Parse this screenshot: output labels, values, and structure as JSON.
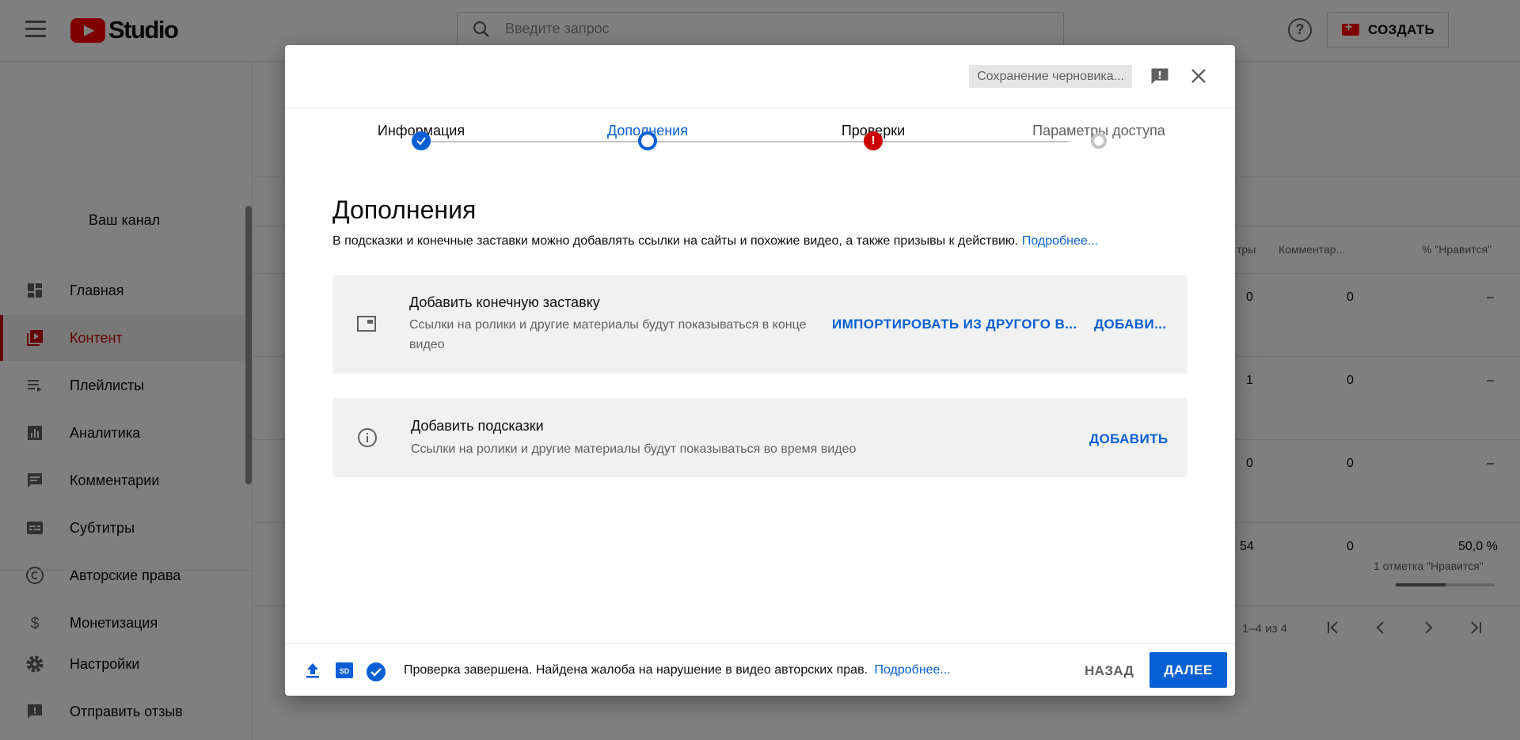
{
  "app": {
    "logo_text": "Studio",
    "create_label": "СОЗДАТЬ",
    "help_glyph": "?"
  },
  "search": {
    "placeholder": "Введите запрос"
  },
  "sidebar": {
    "channel_label": "Ваш канал",
    "items": [
      {
        "label": "Главная",
        "icon": "dashboard-icon"
      },
      {
        "label": "Контент",
        "icon": "content-icon",
        "active": true
      },
      {
        "label": "Плейлисты",
        "icon": "playlist-icon"
      },
      {
        "label": "Аналитика",
        "icon": "analytics-icon"
      },
      {
        "label": "Комментарии",
        "icon": "comments-icon"
      },
      {
        "label": "Субтитры",
        "icon": "subtitles-icon"
      },
      {
        "label": "Авторские права",
        "icon": "copyright-icon"
      },
      {
        "label": "Монетизация",
        "icon": "dollar-icon"
      },
      {
        "label": "Настройки",
        "icon": "gear-icon"
      },
      {
        "label": "Отправить отзыв",
        "icon": "feedback-icon"
      }
    ]
  },
  "table": {
    "headers": {
      "views": "тры",
      "comments": "Комментар...",
      "likes": "% \"Нравится\""
    },
    "rows": [
      {
        "views": "0",
        "comments": "0",
        "likes": "–"
      },
      {
        "views": "1",
        "comments": "0",
        "likes": "–"
      },
      {
        "views": "0",
        "comments": "0",
        "likes": "–"
      },
      {
        "views": "54",
        "comments": "0",
        "likes": "50,0 %",
        "likes_sub": "1 отметка \"Нравится\"",
        "likes_ratio": 0.5
      }
    ],
    "pager": "1–4 из 4"
  },
  "dialog": {
    "draft_status": "Сохранение черновика...",
    "steps": [
      {
        "label": "Информация",
        "state": "done"
      },
      {
        "label": "Дополнения",
        "state": "current"
      },
      {
        "label": "Проверки",
        "state": "error"
      },
      {
        "label": "Параметры доступа",
        "state": "todo"
      }
    ],
    "error_glyph": "!",
    "title": "Дополнения",
    "description": "В подсказки и конечные заставки можно добавлять ссылки на сайты и похожие видео, а также призывы к действию.",
    "learn_more": "Подробнее...",
    "end_screen": {
      "title": "Добавить конечную заставку",
      "subtitle_line1": "Ссылки на ролики и другие материалы будут показываться в конце",
      "subtitle_line2": "видео",
      "import_label": "ИМПОРТИРОВАТЬ ИЗ ДРУГОГО В...",
      "add_label": "ДОБАВИ..."
    },
    "cards": {
      "title": "Добавить подсказки",
      "subtitle": "Ссылки на ролики и другие материалы будут показываться во время видео",
      "add_label": "ДОБАВИТЬ"
    },
    "footer": {
      "status": "Проверка завершена. Найдена жалоба на нарушение в видео авторских прав.",
      "learn_more": "Подробнее...",
      "quality_badge": "SD",
      "back_label": "НАЗАД",
      "next_label": "ДАЛЕЕ"
    }
  },
  "colors": {
    "accent": "#065fd4",
    "brand_red": "#ff0000",
    "error": "#cc0000"
  }
}
